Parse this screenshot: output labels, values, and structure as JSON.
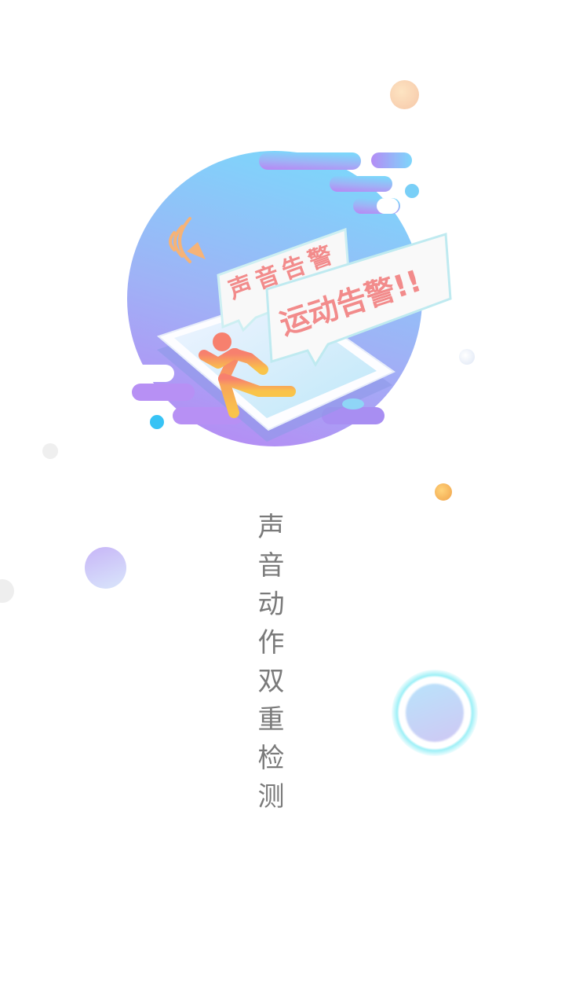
{
  "illustration": {
    "bubble_sound_label": "声音告警",
    "bubble_motion_label": "运动告警!!"
  },
  "tagline": "声音动作双重检测",
  "colors": {
    "blob_top": "#7dd6fb",
    "blob_bottom": "#b58cf4",
    "bubble_text": "#f28b8b",
    "tagline_text": "#7a7a7a",
    "figure": "#f7806e"
  }
}
